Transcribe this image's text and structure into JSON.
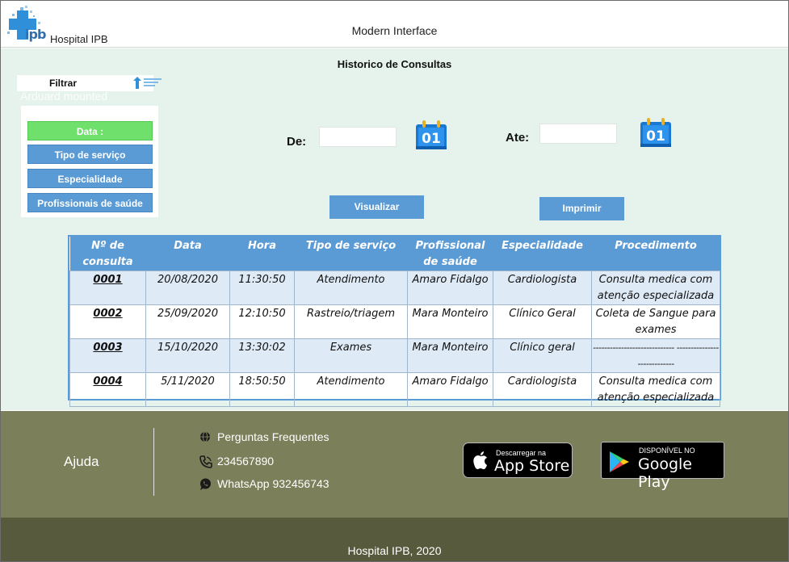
{
  "header": {
    "logo_text": "ipb",
    "hospital_name": "Hospital IPB",
    "app_title": "Modern Interface"
  },
  "main": {
    "page_title": "Historico de Consultas",
    "filter": {
      "label": "Filtrar",
      "ghost_text": "Arduard mounted",
      "options": [
        {
          "label": "Data :",
          "active": true
        },
        {
          "label": "Tipo de serviço",
          "active": false
        },
        {
          "label": "Especialidade",
          "active": false
        },
        {
          "label": "Profissionais de saúde",
          "active": false
        }
      ]
    },
    "date_from": {
      "label": "De:",
      "value": "",
      "icon": "calendar-icon",
      "icon_text": "01"
    },
    "date_to": {
      "label": "Ate:",
      "value": "",
      "icon": "calendar-icon",
      "icon_text": "01"
    },
    "buttons": {
      "view": "Visualizar",
      "print": "Imprimir"
    }
  },
  "table": {
    "headers": [
      "Nº de consulta",
      "Data",
      "Hora",
      "Tipo de serviço",
      "Profissional de saúde",
      "Especialidade",
      "Procedimento"
    ],
    "rows": [
      {
        "id": "0001",
        "date": "20/08/2020",
        "time": "11:30:50",
        "service": "Atendimento",
        "professional": "Amaro Fidalgo",
        "specialty": "Cardiologista",
        "procedure": "Consulta medica com atenção especializada"
      },
      {
        "id": "0002",
        "date": "25/09/2020",
        "time": "12:10:50",
        "service": "Rastreio/triagem",
        "professional": "Mara Monteiro",
        "specialty": "Clínico Geral",
        "procedure": "Coleta de Sangue para exames"
      },
      {
        "id": "0003",
        "date": "15/10/2020",
        "time": "13:30:02",
        "service": "Exames",
        "professional": "Mara Monteiro",
        "specialty": "Clínico geral",
        "procedure": "----------------------------- ----------------------------"
      },
      {
        "id": "0004",
        "date": "5/11/2020",
        "time": "18:50:50",
        "service": "Atendimento",
        "professional": "Amaro Fidalgo",
        "specialty": "Cardiologista",
        "procedure": "Consulta medica com atenção especializada"
      }
    ]
  },
  "footer": {
    "help_title": "Ajuda",
    "faq": "Perguntas Frequentes",
    "phone": "234567890",
    "whatsapp": "WhatsApp 932456743",
    "app_store": {
      "small": "Descarregar na",
      "big": "App Store"
    },
    "google_play": {
      "small": "DISPONÍVEL NO",
      "big": "Google Play"
    },
    "copyright": "Hospital IPB, 2020"
  },
  "colors": {
    "accent_blue": "#5b9bd5",
    "active_green": "#6ee06b",
    "main_bg": "#e6f3ec",
    "footer_bg": "#7b7f5a",
    "bottom_bar_bg": "#575a3c"
  }
}
